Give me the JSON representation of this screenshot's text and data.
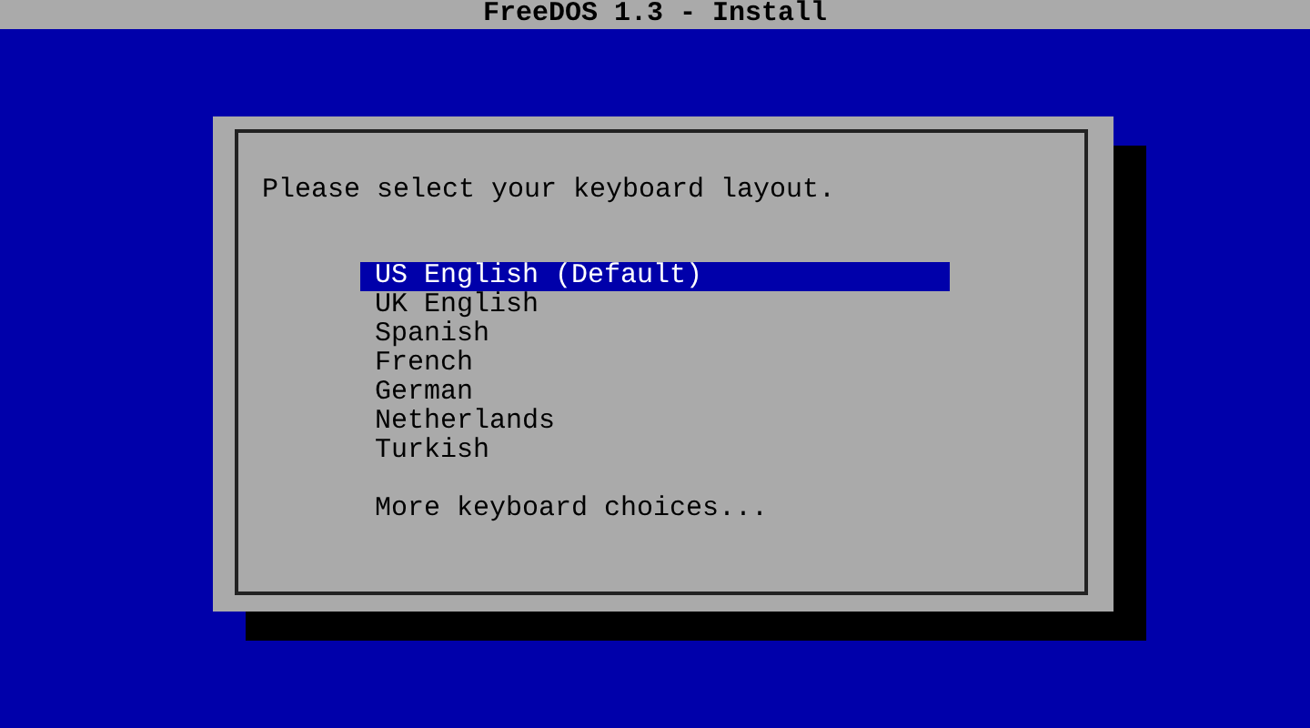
{
  "window": {
    "title": "FreeDOS 1.3 - Install"
  },
  "dialog": {
    "prompt": "Please select your keyboard layout.",
    "options": [
      {
        "label": "US English (Default)",
        "selected": true,
        "kind": "layout"
      },
      {
        "label": "UK English",
        "selected": false,
        "kind": "layout"
      },
      {
        "label": "Spanish",
        "selected": false,
        "kind": "layout"
      },
      {
        "label": "French",
        "selected": false,
        "kind": "layout"
      },
      {
        "label": "German",
        "selected": false,
        "kind": "layout"
      },
      {
        "label": "Netherlands",
        "selected": false,
        "kind": "layout"
      },
      {
        "label": "Turkish",
        "selected": false,
        "kind": "layout"
      },
      {
        "label": "More keyboard choices...",
        "selected": false,
        "kind": "more"
      }
    ]
  }
}
